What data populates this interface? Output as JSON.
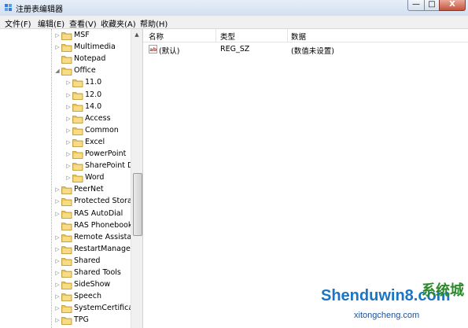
{
  "window": {
    "title": "注册表编辑器",
    "controls": {
      "minimize": "—",
      "maximize": "□",
      "close": "X"
    }
  },
  "menu": [
    "文件(F)",
    "编辑(E)",
    "查看(V)",
    "收藏夹(A)",
    "帮助(H)"
  ],
  "tree": {
    "items": [
      {
        "label": "MSF",
        "level": 0,
        "expanded": false
      },
      {
        "label": "Multimedia",
        "level": 0,
        "expanded": false
      },
      {
        "label": "Notepad",
        "level": 0,
        "expanded": null
      },
      {
        "label": "Office",
        "level": 0,
        "expanded": true
      },
      {
        "label": "11.0",
        "level": 1,
        "expanded": false
      },
      {
        "label": "12.0",
        "level": 1,
        "expanded": false
      },
      {
        "label": "14.0",
        "level": 1,
        "expanded": false
      },
      {
        "label": "Access",
        "level": 1,
        "expanded": false
      },
      {
        "label": "Common",
        "level": 1,
        "expanded": false
      },
      {
        "label": "Excel",
        "level": 1,
        "expanded": false
      },
      {
        "label": "PowerPoint",
        "level": 1,
        "expanded": false
      },
      {
        "label": "SharePoint D",
        "level": 1,
        "expanded": false
      },
      {
        "label": "Word",
        "level": 1,
        "expanded": false
      },
      {
        "label": "PeerNet",
        "level": 0,
        "expanded": false
      },
      {
        "label": "Protected Storag",
        "level": 0,
        "expanded": false
      },
      {
        "label": "RAS AutoDial",
        "level": 0,
        "expanded": false
      },
      {
        "label": "RAS Phonebook",
        "level": 0,
        "expanded": null
      },
      {
        "label": "Remote Assistan",
        "level": 0,
        "expanded": false
      },
      {
        "label": "RestartManager",
        "level": 0,
        "expanded": false
      },
      {
        "label": "Shared",
        "level": 0,
        "expanded": false
      },
      {
        "label": "Shared Tools",
        "level": 0,
        "expanded": false
      },
      {
        "label": "SideShow",
        "level": 0,
        "expanded": false
      },
      {
        "label": "Speech",
        "level": 0,
        "expanded": false
      },
      {
        "label": "SystemCertificate",
        "level": 0,
        "expanded": false
      },
      {
        "label": "TPG",
        "level": 0,
        "expanded": false
      }
    ]
  },
  "list": {
    "columns": [
      "名称",
      "类型",
      "数据"
    ],
    "rows": [
      {
        "icon": "reg-sz-icon",
        "name": "(默认)",
        "type": "REG_SZ",
        "data": "(数值未设置)"
      }
    ]
  },
  "watermark": {
    "text": "Shenduwin8.com",
    "cn": "系统城",
    "sub": "xitongcheng.com"
  },
  "colors": {
    "folder": "#e8c45a",
    "titlebar": "#dbe6f4",
    "close": "#c4533d",
    "watermark": "#1b74c4"
  }
}
